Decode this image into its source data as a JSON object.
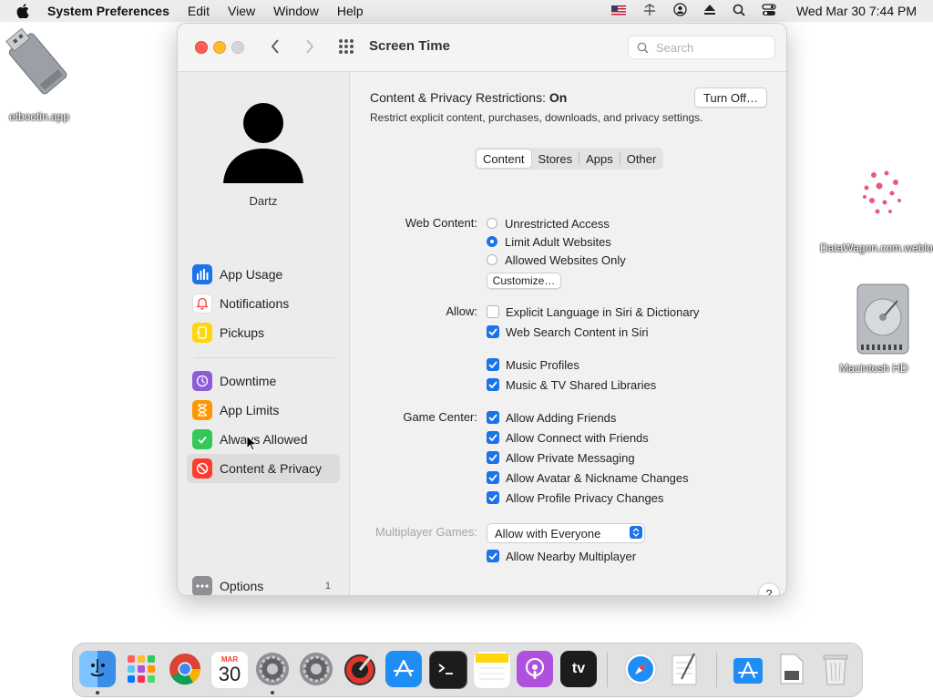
{
  "menubar": {
    "app_name": "System Preferences",
    "menus": [
      "Edit",
      "View",
      "Window",
      "Help"
    ],
    "clock": "Wed Mar 30  7:44 PM"
  },
  "desktop": {
    "icons": [
      {
        "label": "etbootin.app"
      },
      {
        "label": "DataWagon.com.webloc"
      },
      {
        "label": "Macintosh HD"
      }
    ]
  },
  "window": {
    "title": "Screen Time",
    "search_placeholder": "Search"
  },
  "sidebar": {
    "username": "Dartz",
    "items": [
      {
        "label": "App Usage",
        "icon": "app-usage-icon",
        "color": "#1a73e8"
      },
      {
        "label": "Notifications",
        "icon": "bell-icon",
        "color": "#ffffff"
      },
      {
        "label": "Pickups",
        "icon": "pickups-icon",
        "color": "#ffd60a"
      },
      {
        "label": "Downtime",
        "icon": "downtime-icon",
        "color": "#8e5cd9"
      },
      {
        "label": "App Limits",
        "icon": "hourglass-icon",
        "color": "#ff9500"
      },
      {
        "label": "Always Allowed",
        "icon": "checkmark-icon",
        "color": "#34c759"
      },
      {
        "label": "Content & Privacy",
        "icon": "no-entry-icon",
        "color": "#ff3b30"
      }
    ],
    "options": {
      "label": "Options",
      "badge": "1"
    }
  },
  "main": {
    "restrictions_label": "Content & Privacy Restrictions: ",
    "restrictions_state": "On",
    "restrictions_sub": "Restrict explicit content, purchases, downloads, and privacy settings.",
    "turn_off_label": "Turn Off…",
    "tabs": [
      "Content",
      "Stores",
      "Apps",
      "Other"
    ],
    "active_tab": "Content",
    "web_content": {
      "label": "Web Content:",
      "options": [
        "Unrestricted Access",
        "Limit Adult Websites",
        "Allowed Websites Only"
      ],
      "selected": "Limit Adult Websites",
      "customize_label": "Customize…"
    },
    "allow": {
      "label": "Allow:",
      "options": [
        {
          "label": "Explicit Language in Siri & Dictionary",
          "checked": false
        },
        {
          "label": "Web Search Content in Siri",
          "checked": true
        },
        {
          "label": "Music Profiles",
          "checked": true
        },
        {
          "label": "Music & TV Shared Libraries",
          "checked": true
        }
      ]
    },
    "game_center": {
      "label": "Game Center:",
      "options": [
        {
          "label": "Allow Adding Friends",
          "checked": true
        },
        {
          "label": "Allow Connect with Friends",
          "checked": true
        },
        {
          "label": "Allow Private Messaging",
          "checked": true
        },
        {
          "label": "Allow Avatar & Nickname Changes",
          "checked": true
        },
        {
          "label": "Allow Profile Privacy Changes",
          "checked": true
        }
      ]
    },
    "multiplayer": {
      "label": "Multiplayer Games:",
      "value": "Allow with Everyone",
      "nearby_label": "Allow Nearby Multiplayer",
      "nearby_checked": true
    },
    "help_label": "?"
  },
  "dock": {
    "apps": [
      "finder",
      "launchpad",
      "chrome",
      "calendar",
      "system-preferences",
      "system-preferences-alt",
      "instruments",
      "app-store",
      "terminal",
      "notes",
      "podcasts",
      "apple-tv",
      "safari",
      "textedit",
      "app-store-downloads",
      "document",
      "trash"
    ],
    "calendar_month": "MAR",
    "calendar_day": "30",
    "tv_label": "tv"
  },
  "accent_color": "#1a73e8"
}
